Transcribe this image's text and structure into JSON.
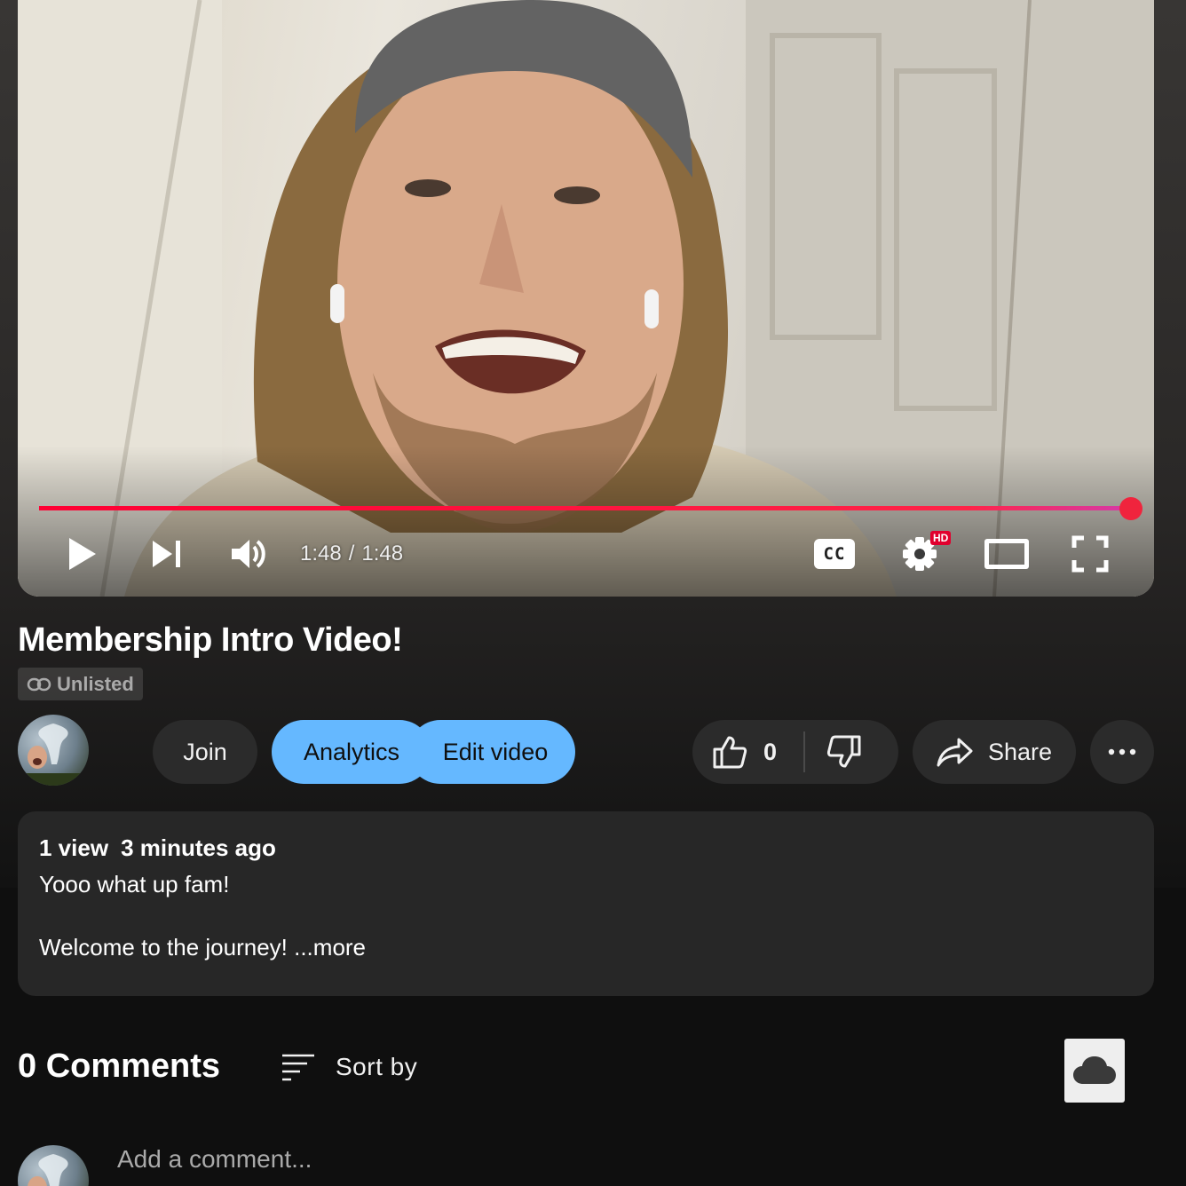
{
  "player": {
    "current_time": "1:48",
    "separator": "/",
    "duration": "1:48",
    "progress": 1.0,
    "hd_badge": "HD",
    "cc_label": "CC",
    "accent_color": "#ff0033"
  },
  "video": {
    "title": "Membership Intro Video!",
    "visibility": "Unlisted"
  },
  "actions": {
    "join_label": "Join",
    "analytics_label": "Analytics",
    "edit_label": "Edit video",
    "like_count": "0",
    "share_label": "Share"
  },
  "description": {
    "views": "1 view",
    "age": "3 minutes ago",
    "line1": "Yooo what up fam!",
    "line2": "Welcome to the journey!",
    "more": " ...more"
  },
  "comments": {
    "count_label": "0 Comments",
    "sort_label": "Sort by",
    "placeholder": "Add a comment..."
  },
  "icons": {
    "play": "play-icon",
    "next": "next-icon",
    "volume": "volume-icon",
    "captions": "captions-icon",
    "settings": "gear-icon",
    "theater": "theater-mode-icon",
    "fullscreen": "fullscreen-icon",
    "link": "link-icon",
    "like": "thumbs-up-icon",
    "dislike": "thumbs-down-icon",
    "share": "share-arrow-icon",
    "more": "more-horizontal-icon",
    "sort": "sort-icon",
    "cloud": "cloud-icon"
  }
}
